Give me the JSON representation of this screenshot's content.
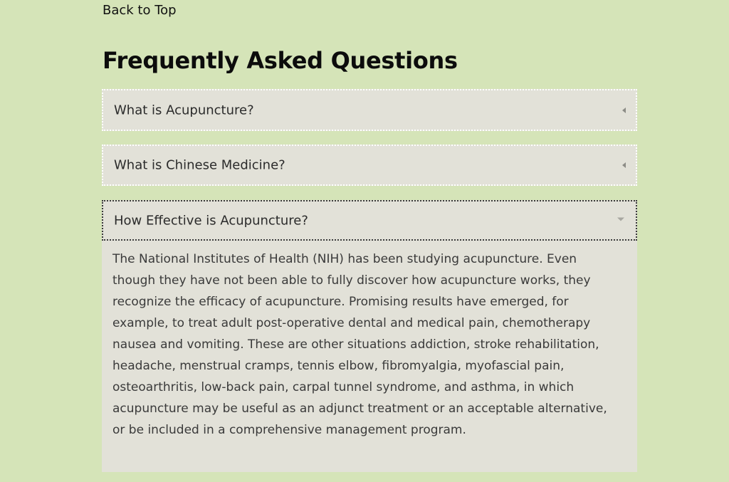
{
  "nav": {
    "back_to_top": "Back to Top"
  },
  "faq": {
    "title": "Frequently Asked Questions",
    "items": [
      {
        "question": "What is Acupuncture?",
        "expanded": false,
        "icon": "caret-left-icon"
      },
      {
        "question": "What is Chinese Medicine?",
        "expanded": false,
        "icon": "caret-left-icon"
      },
      {
        "question": "How Effective is Acupuncture?",
        "expanded": true,
        "icon": "caret-down-icon",
        "answer": "The National Institutes of Health (NIH) has been studying acupuncture. Even though they have not been able to fully discover how acupuncture works, they recognize the efficacy of acupuncture. Promising results have emerged, for example, to treat adult post-operative dental and medical pain, chemotherapy nausea and vomiting. These are other situations addiction, stroke rehabilitation, headache, menstrual cramps, tennis elbow, fibromyalgia, myofascial pain, osteoarthritis, low-back pain, carpal tunnel syndrome, and asthma, in which acupuncture may be useful as an adjunct treatment or an acceptable alternative, or be included in a comprehensive management program."
      }
    ]
  },
  "colors": {
    "page_background": "#d5e4b8",
    "panel_background": "#e2e1d8",
    "title_text": "#0c0c0c",
    "body_text": "#3a3a3a"
  }
}
